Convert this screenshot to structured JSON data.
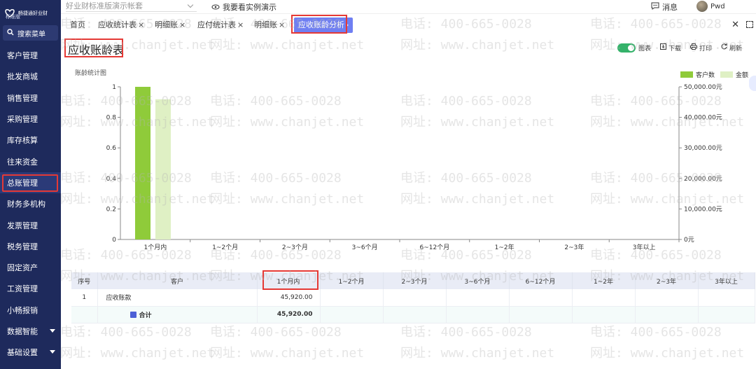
{
  "app": {
    "brand": "畅捷通好业财",
    "edition": "标准版",
    "account_select": "好业财标准版演示帐套",
    "demo_link": "我要看实例演示",
    "messages": "消息",
    "user_name": "Pwd"
  },
  "sidebar": {
    "search_label": "搜索菜单",
    "items": [
      {
        "label": "客户管理"
      },
      {
        "label": "批发商城"
      },
      {
        "label": "销售管理"
      },
      {
        "label": "采购管理"
      },
      {
        "label": "库存核算"
      },
      {
        "label": "往来资金"
      },
      {
        "label": "总账管理",
        "active": true
      },
      {
        "label": "财务多机构"
      },
      {
        "label": "发票管理"
      },
      {
        "label": "税务管理"
      },
      {
        "label": "固定资产"
      },
      {
        "label": "工资管理"
      },
      {
        "label": "小畅报销"
      },
      {
        "label": "数据智能",
        "expandable": true
      },
      {
        "label": "基础设置",
        "expandable": true
      }
    ]
  },
  "tabs": [
    {
      "label": "首页",
      "closable": false
    },
    {
      "label": "应收统计表",
      "closable": true
    },
    {
      "label": "明细账",
      "closable": true
    },
    {
      "label": "应付统计表",
      "closable": true
    },
    {
      "label": "明细账",
      "closable": true
    },
    {
      "label": "应收账龄分析",
      "closable": false,
      "active": true,
      "suffix": "›"
    }
  ],
  "page": {
    "title": "应收账龄表",
    "toolbar": {
      "chart_toggle": "图表",
      "download": "下载",
      "print": "打印",
      "refresh": "刷新"
    }
  },
  "chart_data": {
    "type": "bar",
    "title": "账龄统计图",
    "categories": [
      "1个月内",
      "1~2个月",
      "2~3个月",
      "3~6个月",
      "6~12个月",
      "1~2年",
      "2~3年",
      "3年以上"
    ],
    "series": [
      {
        "name": "客户数",
        "axis": "left",
        "color": "#8fcb3a",
        "values": [
          1,
          0,
          0,
          0,
          0,
          0,
          0,
          0
        ]
      },
      {
        "name": "金额",
        "axis": "right",
        "color": "#dff0c4",
        "values": [
          45920,
          0,
          0,
          0,
          0,
          0,
          0,
          0
        ]
      }
    ],
    "y_left": {
      "ticks": [
        "0",
        "0.2",
        "0.4",
        "0.6",
        "0.8",
        "1"
      ],
      "ylim": [
        0,
        1
      ]
    },
    "y_right": {
      "ticks": [
        "0元",
        "10,000.00元",
        "20,000.00元",
        "30,000.00元",
        "40,000.00元",
        "50,000.00元"
      ],
      "ylim": [
        0,
        50000
      ]
    },
    "legend_position": "top-right",
    "grid": false
  },
  "table": {
    "columns": [
      "序号",
      "客户",
      "1个月内",
      "1~2个月",
      "2~3个月",
      "3~6个月",
      "6~12个月",
      "1~2年",
      "2~3年",
      "3年以上"
    ],
    "rows": [
      {
        "index": "1",
        "customer": "应收账款",
        "values": [
          "45,920.00",
          "",
          "",
          "",
          "",
          "",
          "",
          ""
        ]
      }
    ],
    "total": {
      "label": "合计",
      "values": [
        "45,920.00",
        "",
        "",
        "",
        "",
        "",
        "",
        ""
      ]
    }
  },
  "watermark": {
    "phone": "电话: 400-665-0028",
    "site": "网址: www.chanjet.net"
  }
}
